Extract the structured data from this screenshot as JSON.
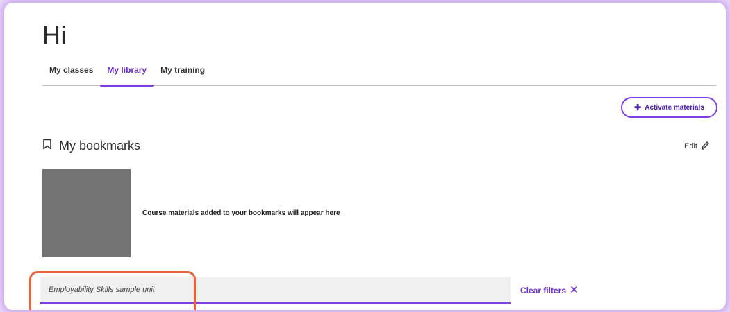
{
  "page": {
    "greeting": "Hi"
  },
  "tabs": [
    {
      "label": "My classes",
      "active": false
    },
    {
      "label": "My library",
      "active": true
    },
    {
      "label": "My training",
      "active": false
    }
  ],
  "actions": {
    "activate_label": "Activate materials",
    "activate_icon": "plus-icon"
  },
  "bookmarks": {
    "title": "My bookmarks",
    "title_icon": "bookmark-icon",
    "edit_label": "Edit",
    "edit_icon": "pencil-icon",
    "empty_message": "Course materials added to your bookmarks will appear here"
  },
  "filters": {
    "active_filter": "Employability Skills sample unit",
    "clear_label": "Clear filters",
    "clear_icon": "close-icon"
  },
  "colors": {
    "accent": "#7b3fe4",
    "accent_text": "#6a2fcf",
    "highlight": "#e8633a",
    "thumbnail": "#737373"
  }
}
